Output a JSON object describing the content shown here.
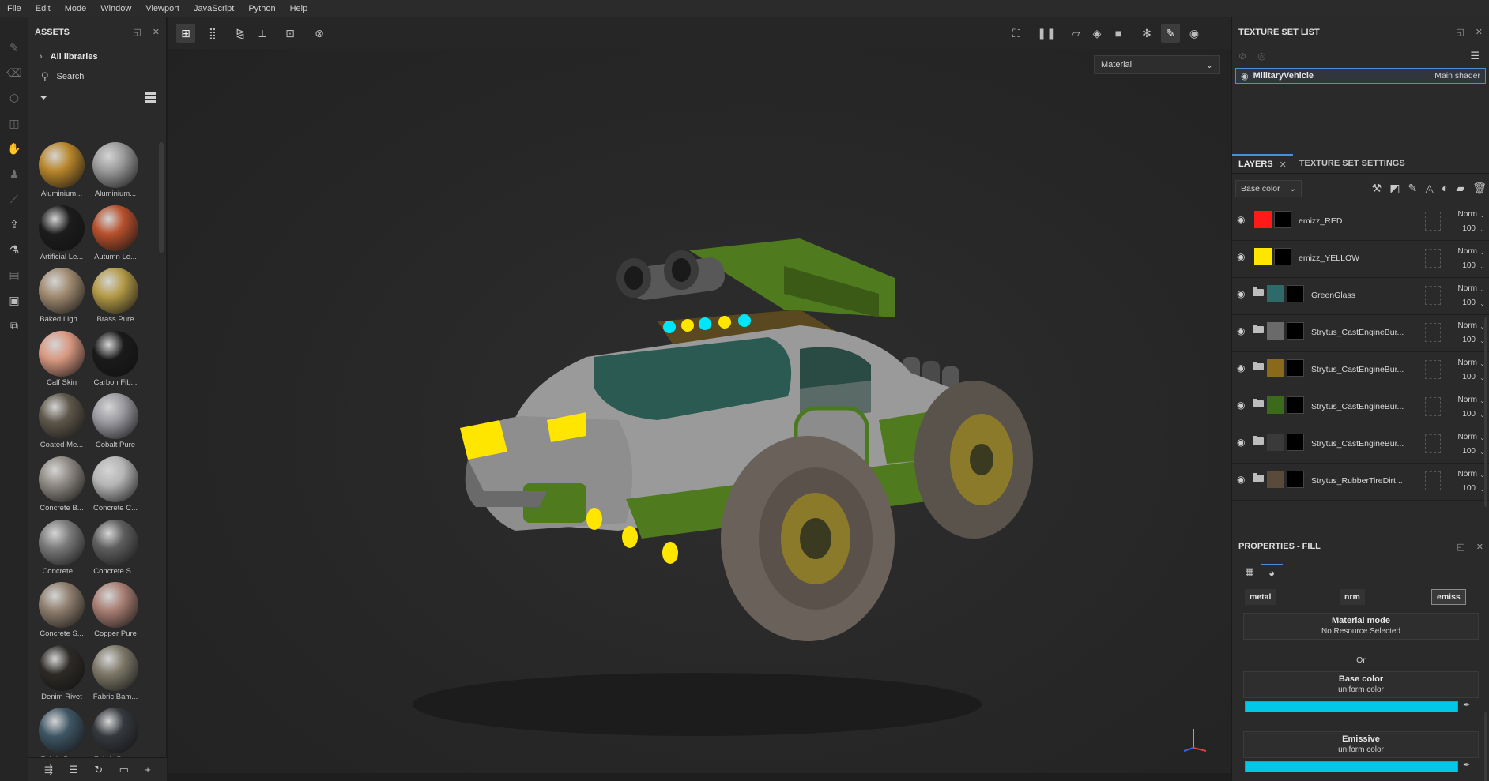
{
  "menu": [
    "File",
    "Edit",
    "Mode",
    "Window",
    "Viewport",
    "JavaScript",
    "Python",
    "Help"
  ],
  "assets": {
    "title": "ASSETS",
    "libraries_label": "All libraries",
    "search_placeholder": "Search",
    "items": [
      {
        "name": "Aluminium...",
        "swatch": "#b8862a"
      },
      {
        "name": "Aluminium...",
        "swatch": "#9a9a9a"
      },
      {
        "name": "Artificial Le...",
        "swatch": "#1c1c1c"
      },
      {
        "name": "Autumn Le...",
        "swatch": "#b7502c"
      },
      {
        "name": "Baked Ligh...",
        "swatch": "#a08a70"
      },
      {
        "name": "Brass Pure",
        "swatch": "#b39a45"
      },
      {
        "name": "Calf Skin",
        "swatch": "#d89880"
      },
      {
        "name": "Carbon Fib...",
        "swatch": "#1a1a1a"
      },
      {
        "name": "Coated Me...",
        "swatch": "#5d574a"
      },
      {
        "name": "Cobalt Pure",
        "swatch": "#9a9aa0"
      },
      {
        "name": "Concrete B...",
        "swatch": "#8f8a84"
      },
      {
        "name": "Concrete C...",
        "swatch": "#b5b5b5"
      },
      {
        "name": "Concrete ...",
        "swatch": "#7a7a7a"
      },
      {
        "name": "Concrete S...",
        "swatch": "#5e5e5e"
      },
      {
        "name": "Concrete S...",
        "swatch": "#8e7e6e"
      },
      {
        "name": "Copper Pure",
        "swatch": "#a87e72"
      },
      {
        "name": "Denim Rivet",
        "swatch": "#2d2a26"
      },
      {
        "name": "Fabric Bam...",
        "swatch": "#7d7868"
      },
      {
        "name": "Fabric Bas...",
        "swatch": "#3e5564"
      },
      {
        "name": "Fabric Den...",
        "swatch": "#35383d"
      }
    ]
  },
  "viewport": {
    "material_mode": "Material"
  },
  "texture_set_list": {
    "title": "TEXTURE SET LIST",
    "set_name": "MilitaryVehicle",
    "shader": "Main shader"
  },
  "layers_panel": {
    "tabs": [
      "LAYERS",
      "TEXTURE SET SETTINGS"
    ],
    "channel": "Base color",
    "layers": [
      {
        "name": "emizz_RED",
        "blend": "Norm",
        "opacity": "100",
        "folder": false,
        "color": "#ff1a1a",
        "mask": "#000000"
      },
      {
        "name": "emizz_YELLOW",
        "blend": "Norm",
        "opacity": "100",
        "folder": false,
        "color": "#ffe600",
        "mask": "#000000"
      },
      {
        "name": "GreenGlass",
        "blend": "Norm",
        "opacity": "100",
        "folder": true,
        "color": "#2f6a6a",
        "mask": "#000000"
      },
      {
        "name": "Strytus_CastEngineBur...",
        "blend": "Norm",
        "opacity": "100",
        "folder": true,
        "color": "#6a6a6a",
        "mask": "#000000"
      },
      {
        "name": "Strytus_CastEngineBur...",
        "blend": "Norm",
        "opacity": "100",
        "folder": true,
        "color": "#8a6a1a",
        "mask": "#000000"
      },
      {
        "name": "Strytus_CastEngineBur...",
        "blend": "Norm",
        "opacity": "100",
        "folder": true,
        "color": "#3a6a1a",
        "mask": "#000000"
      },
      {
        "name": "Strytus_CastEngineBur...",
        "blend": "Norm",
        "opacity": "100",
        "folder": true,
        "color": "#3a3a3a",
        "mask": "#000000"
      },
      {
        "name": "Strytus_RubberTireDirt...",
        "blend": "Norm",
        "opacity": "100",
        "folder": true,
        "color": "#5a4a3a",
        "mask": "#000000"
      }
    ]
  },
  "properties": {
    "title": "PROPERTIES - FILL",
    "channels": [
      "metal",
      "nrm",
      "emiss"
    ],
    "material_mode_label": "Material mode",
    "material_mode_value": "No Resource Selected",
    "or_label": "Or",
    "base_color_label": "Base color",
    "base_color_mode": "uniform color",
    "base_color_value": "#00c8e6",
    "emissive_label": "Emissive",
    "emissive_mode": "uniform color",
    "emissive_value": "#00c8e6"
  }
}
